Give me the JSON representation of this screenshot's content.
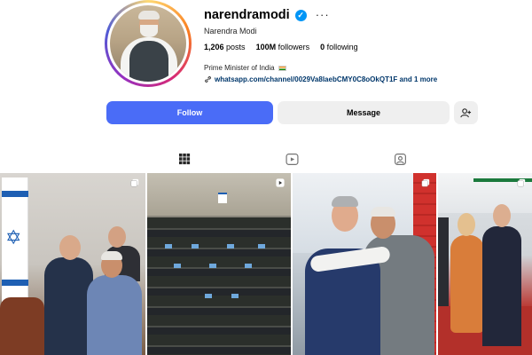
{
  "profile": {
    "username": "narendramodi",
    "full_name": "Narendra Modi",
    "posts_count": "1,206",
    "posts_label": "posts",
    "followers_count": "100M",
    "followers_label": "followers",
    "following_count": "0",
    "following_label": "following",
    "bio": "Prime Minister of India",
    "link_text": "whatsapp.com/channel/0029Va8laebCMY0C8oOkQT1F and 1 more",
    "verified": true
  },
  "actions": {
    "follow_label": "Follow",
    "message_label": "Message",
    "suggest_icon": "add-person-icon"
  },
  "tabs": [
    {
      "name": "posts",
      "icon": "grid-icon",
      "active": true
    },
    {
      "name": "reels",
      "icon": "reels-icon",
      "active": false
    },
    {
      "name": "tagged",
      "icon": "tagged-icon",
      "active": false
    }
  ],
  "grid": [
    {
      "overlay_icon": "carousel-icon"
    },
    {
      "overlay_icon": "reel-icon"
    },
    {
      "overlay_icon": "carousel-icon"
    },
    {
      "overlay_icon": "carousel-icon"
    }
  ],
  "colors": {
    "accent": "#4a6cf7",
    "verified": "#0095f6",
    "link": "#00376b"
  }
}
